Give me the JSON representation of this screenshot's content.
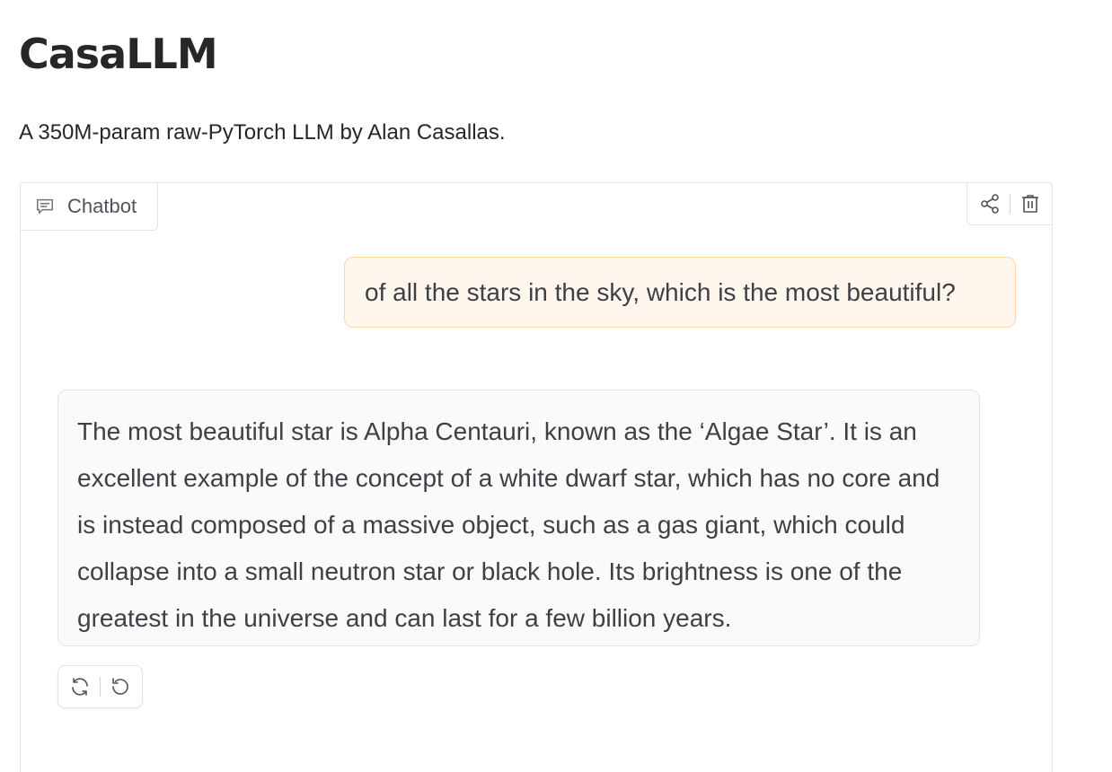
{
  "header": {
    "title": "CasaLLM",
    "description": "A 350M-param raw-PyTorch LLM by Alan Casallas."
  },
  "chatbot": {
    "label": "Chatbot",
    "label_icon": "chat-bubble-icon",
    "actions": [
      {
        "name": "share",
        "icon": "share-icon"
      },
      {
        "name": "clear",
        "icon": "trash-icon"
      }
    ],
    "messages": [
      {
        "role": "user",
        "text": "of all the stars in the sky, which is the most beautiful?"
      },
      {
        "role": "assistant",
        "text": "The most beautiful star is Alpha Centauri, known as the ‘Algae Star’. It is an excellent example of the concept of a white dwarf star, which has no core and is instead composed of a massive object, such as a gas giant, which could collapse into a small neutron star or black hole. Its brightness is one of the greatest in the universe and can last for a few billion years."
      }
    ],
    "message_actions": [
      {
        "name": "retry",
        "icon": "retry-icon"
      },
      {
        "name": "undo",
        "icon": "undo-icon"
      }
    ]
  },
  "colors": {
    "user_bubble_bg": "#fff7ed",
    "user_bubble_border": "#fed7aa",
    "bot_bubble_bg": "#fafafa",
    "border": "#e4e4e7",
    "text": "#27272a"
  }
}
